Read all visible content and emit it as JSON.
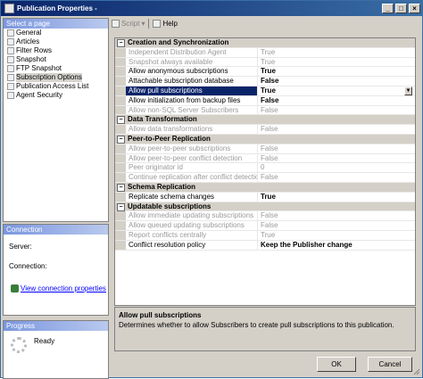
{
  "window": {
    "title": "Publication Properties -",
    "controls": [
      "_",
      "□",
      "×"
    ]
  },
  "select_page": {
    "header": "Select a page",
    "items": [
      "General",
      "Articles",
      "Filter Rows",
      "Snapshot",
      "FTP Snapshot",
      "Subscription Options",
      "Publication Access List",
      "Agent Security"
    ],
    "selected": "Subscription Options"
  },
  "toolbar": {
    "script": "Script",
    "help": "Help"
  },
  "connection": {
    "header": "Connection",
    "server": "Server:",
    "connection": "Connection:",
    "link": "View connection properties"
  },
  "progress": {
    "header": "Progress",
    "status": "Ready"
  },
  "grid": {
    "rows": [
      {
        "type": "cat",
        "name": "Creation and Synchronization"
      },
      {
        "name": "Independent Distribution Agent",
        "value": "True",
        "disabled": true
      },
      {
        "name": "Snapshot always available",
        "value": "True",
        "disabled": true
      },
      {
        "name": "Allow anonymous subscriptions",
        "value": "True",
        "bold": true
      },
      {
        "name": "Attachable subscription database",
        "value": "False",
        "bold": true
      },
      {
        "name": "Allow pull subscriptions",
        "value": "True",
        "bold": true,
        "selected": true
      },
      {
        "name": "Allow initialization from backup files",
        "value": "False",
        "bold": true
      },
      {
        "name": "Allow non-SQL Server Subscribers",
        "value": "False",
        "disabled": true
      },
      {
        "type": "cat",
        "name": "Data Transformation"
      },
      {
        "name": "Allow data transformations",
        "value": "False",
        "disabled": true
      },
      {
        "type": "cat",
        "name": "Peer-to-Peer Replication"
      },
      {
        "name": "Allow peer-to-peer subscriptions",
        "value": "False",
        "disabled": true
      },
      {
        "name": "Allow peer-to-peer conflict detection",
        "value": "False",
        "disabled": true
      },
      {
        "name": "Peer originator id",
        "value": "0",
        "disabled": true
      },
      {
        "name": "Continue replication after conflict detection",
        "value": "False",
        "disabled": true
      },
      {
        "type": "cat",
        "name": "Schema Replication"
      },
      {
        "name": "Replicate schema changes",
        "value": "True",
        "bold": true
      },
      {
        "type": "cat",
        "name": "Updatable subscriptions"
      },
      {
        "name": "Allow immediate updating subscriptions",
        "value": "False",
        "disabled": true
      },
      {
        "name": "Allow queued updating subscriptions",
        "value": "False",
        "disabled": true
      },
      {
        "name": "Report conflicts centrally",
        "value": "True",
        "disabled": true
      },
      {
        "name": "Conflict resolution policy",
        "value": "Keep the Publisher change",
        "bold": true
      }
    ]
  },
  "description": {
    "title": "Allow pull subscriptions",
    "text": "Determines whether to allow Subscribers to create pull subscriptions to this publication."
  },
  "buttons": {
    "ok": "OK",
    "cancel": "Cancel"
  }
}
